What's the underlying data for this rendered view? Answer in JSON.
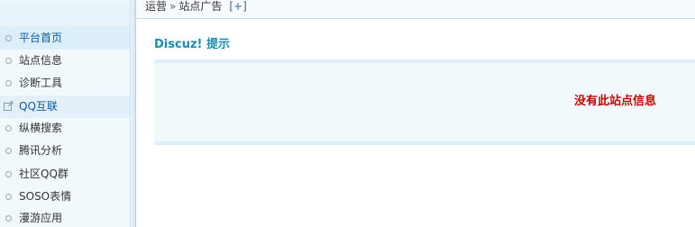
{
  "sidebar": {
    "items": [
      {
        "label": "平台首页"
      },
      {
        "label": "站点信息"
      },
      {
        "label": "诊断工具"
      },
      {
        "label": "QQ互联"
      },
      {
        "label": "纵横搜索"
      },
      {
        "label": "腾讯分析"
      },
      {
        "label": "社区QQ群"
      },
      {
        "label": "SOSO表情"
      },
      {
        "label": "漫游应用"
      }
    ]
  },
  "header": {
    "breadcrumb_parent": "运营",
    "breadcrumb_separator": "»",
    "breadcrumb_current": "站点广告",
    "add_link": "[+]"
  },
  "main": {
    "title": "Discuz! 提示",
    "message": "没有此站点信息"
  },
  "colors": {
    "title": "#1a8bb3",
    "message": "#cc0000",
    "sidebar_bg": "#f2f9fd",
    "message_box_bg": "#f2f9fd"
  },
  "icons": {
    "section": "external-link-icon",
    "item": "circle-bullet-icon"
  }
}
